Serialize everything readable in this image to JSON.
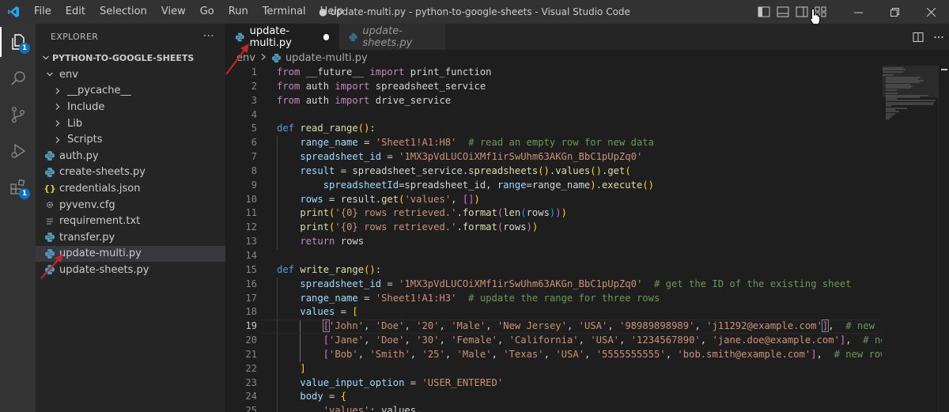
{
  "titlebar": {
    "menu": [
      "File",
      "Edit",
      "Selection",
      "View",
      "Go",
      "Run",
      "Terminal",
      "Help"
    ],
    "window_title": "● update-multi.py - python-to-google-sheets - Visual Studio Code"
  },
  "activity_bar": {
    "explorer_badge": "1",
    "extensions_badge": "1"
  },
  "sidebar": {
    "header": "EXPLORER",
    "more": "···",
    "folder": "PYTHON-TO-GOOGLE-SHEETS",
    "items": [
      {
        "label": "env",
        "type": "folder-open",
        "depth": 0
      },
      {
        "label": "__pycache__",
        "type": "folder",
        "depth": 1
      },
      {
        "label": "Include",
        "type": "folder",
        "depth": 1
      },
      {
        "label": "Lib",
        "type": "folder",
        "depth": 1
      },
      {
        "label": "Scripts",
        "type": "folder",
        "depth": 1
      },
      {
        "label": "auth.py",
        "type": "py",
        "depth": 0
      },
      {
        "label": "create-sheets.py",
        "type": "py",
        "depth": 0
      },
      {
        "label": "credentials.json",
        "type": "json",
        "depth": 0
      },
      {
        "label": "pyvenv.cfg",
        "type": "cfg",
        "depth": 0
      },
      {
        "label": "requirement.txt",
        "type": "txt",
        "depth": 0
      },
      {
        "label": "transfer.py",
        "type": "py",
        "depth": 0
      },
      {
        "label": "update-multi.py",
        "type": "py",
        "depth": 0,
        "selected": true
      },
      {
        "label": "update-sheets.py",
        "type": "py",
        "depth": 0
      }
    ]
  },
  "tabs": [
    {
      "label": "update-multi.py",
      "active": true,
      "dirty": true
    },
    {
      "label": "update-sheets.py",
      "active": false,
      "dirty": false
    }
  ],
  "breadcrumb": {
    "folder": "env",
    "file": "update-multi.py"
  },
  "editor": {
    "current_line": 19,
    "lines": [
      {
        "n": "1",
        "tokens": [
          [
            "k",
            "from "
          ],
          [
            "p",
            "__future__ "
          ],
          [
            "k",
            "import "
          ],
          [
            "p",
            "print_function"
          ]
        ]
      },
      {
        "n": "2",
        "tokens": [
          [
            "k",
            "from "
          ],
          [
            "p",
            "auth "
          ],
          [
            "k",
            "import "
          ],
          [
            "p",
            "spreadsheet_service"
          ]
        ]
      },
      {
        "n": "3",
        "tokens": [
          [
            "k",
            "from "
          ],
          [
            "p",
            "auth "
          ],
          [
            "k",
            "import "
          ],
          [
            "p",
            "drive_service"
          ]
        ]
      },
      {
        "n": "4",
        "tokens": []
      },
      {
        "n": "5",
        "tokens": [
          [
            "kd",
            "def "
          ],
          [
            "f",
            "read_range"
          ],
          [
            "b1",
            "()"
          ],
          [
            "p",
            ":"
          ]
        ]
      },
      {
        "n": "6",
        "tokens": [
          [
            "p",
            "    "
          ],
          [
            "v",
            "range_name"
          ],
          [
            "p",
            " = "
          ],
          [
            "s",
            "'Sheet1!A1:H8'"
          ],
          [
            "p",
            "  "
          ],
          [
            "c",
            "# read an empty row for new data"
          ]
        ]
      },
      {
        "n": "7",
        "tokens": [
          [
            "p",
            "    "
          ],
          [
            "v",
            "spreadsheet_id"
          ],
          [
            "p",
            " = "
          ],
          [
            "s",
            "'1MX3pVdLUCOiXMf1irSwUhm63AKGn_BbC1pUpZq0'"
          ]
        ]
      },
      {
        "n": "8",
        "tokens": [
          [
            "p",
            "    "
          ],
          [
            "v",
            "result"
          ],
          [
            "p",
            " = spreadsheet_service."
          ],
          [
            "f",
            "spreadsheets"
          ],
          [
            "b1",
            "()"
          ],
          [
            "p",
            "."
          ],
          [
            "f",
            "values"
          ],
          [
            "b1",
            "()"
          ],
          [
            "p",
            "."
          ],
          [
            "f",
            "get"
          ],
          [
            "b1",
            "("
          ]
        ]
      },
      {
        "n": "9",
        "tokens": [
          [
            "p",
            "        "
          ],
          [
            "v",
            "spreadsheetId"
          ],
          [
            "p",
            "=spreadsheet_id, "
          ],
          [
            "v",
            "range"
          ],
          [
            "p",
            "=range_name"
          ],
          [
            "b1",
            ")"
          ],
          [
            "p",
            "."
          ],
          [
            "f",
            "execute"
          ],
          [
            "b1",
            "()"
          ]
        ]
      },
      {
        "n": "10",
        "tokens": [
          [
            "p",
            "    "
          ],
          [
            "v",
            "rows"
          ],
          [
            "p",
            " = result."
          ],
          [
            "f",
            "get"
          ],
          [
            "b1",
            "("
          ],
          [
            "s",
            "'values'"
          ],
          [
            "p",
            ", "
          ],
          [
            "b2",
            "[]"
          ],
          [
            "b1",
            ")"
          ]
        ]
      },
      {
        "n": "11",
        "tokens": [
          [
            "p",
            "    "
          ],
          [
            "f",
            "print"
          ],
          [
            "b1",
            "("
          ],
          [
            "s",
            "'{0} rows retrieved.'"
          ],
          [
            "p",
            "."
          ],
          [
            "f",
            "format"
          ],
          [
            "b2",
            "("
          ],
          [
            "f",
            "len"
          ],
          [
            "b3",
            "("
          ],
          [
            "p",
            "rows"
          ],
          [
            "b3",
            ")"
          ],
          [
            "b2",
            ")"
          ],
          [
            "b1",
            ")"
          ]
        ]
      },
      {
        "n": "12",
        "tokens": [
          [
            "p",
            "    "
          ],
          [
            "f",
            "print"
          ],
          [
            "b1",
            "("
          ],
          [
            "s",
            "'{0} rows retrieved.'"
          ],
          [
            "p",
            "."
          ],
          [
            "f",
            "format"
          ],
          [
            "b2",
            "("
          ],
          [
            "p",
            "rows"
          ],
          [
            "b2",
            ")"
          ],
          [
            "b1",
            ")"
          ]
        ]
      },
      {
        "n": "13",
        "tokens": [
          [
            "p",
            "    "
          ],
          [
            "k",
            "return "
          ],
          [
            "p",
            "rows"
          ]
        ]
      },
      {
        "n": "14",
        "tokens": []
      },
      {
        "n": "15",
        "tokens": [
          [
            "kd",
            "def "
          ],
          [
            "f",
            "write_range"
          ],
          [
            "b1",
            "()"
          ],
          [
            "p",
            ":"
          ]
        ]
      },
      {
        "n": "16",
        "tokens": [
          [
            "p",
            "    "
          ],
          [
            "v",
            "spreadsheet_id"
          ],
          [
            "p",
            " = "
          ],
          [
            "s",
            "'1MX3pVdLUCOiXMf1irSwUhm63AKGn_BbC1pUpZq0'"
          ],
          [
            "p",
            "  "
          ],
          [
            "c",
            "# get the ID of the existing sheet"
          ]
        ]
      },
      {
        "n": "17",
        "tokens": [
          [
            "p",
            "    "
          ],
          [
            "v",
            "range_name"
          ],
          [
            "p",
            " = "
          ],
          [
            "s",
            "'Sheet1!A1:H3'"
          ],
          [
            "p",
            "  "
          ],
          [
            "c",
            "# update the range for three rows"
          ]
        ]
      },
      {
        "n": "18",
        "tokens": [
          [
            "p",
            "    "
          ],
          [
            "v",
            "values"
          ],
          [
            "p",
            " = "
          ],
          [
            "b1",
            "["
          ]
        ]
      },
      {
        "n": "19",
        "tokens": [
          [
            "p",
            "        "
          ],
          [
            "b2",
            "["
          ],
          [
            "s",
            "'John'"
          ],
          [
            "p",
            ", "
          ],
          [
            "s",
            "'Doe'"
          ],
          [
            "p",
            ", "
          ],
          [
            "s",
            "'20'"
          ],
          [
            "p",
            ", "
          ],
          [
            "s",
            "'Male'"
          ],
          [
            "p",
            ", "
          ],
          [
            "s",
            "'New Jersey'"
          ],
          [
            "p",
            ", "
          ],
          [
            "s",
            "'USA'"
          ],
          [
            "p",
            ", "
          ],
          [
            "s",
            "'98989898989'"
          ],
          [
            "p",
            ", "
          ],
          [
            "s",
            "'j11292@example.com'"
          ],
          [
            "b2",
            "]"
          ],
          [
            "p",
            ",  "
          ],
          [
            "c",
            "# new row"
          ]
        ]
      },
      {
        "n": "20",
        "tokens": [
          [
            "p",
            "        "
          ],
          [
            "b2",
            "["
          ],
          [
            "s",
            "'Jane'"
          ],
          [
            "p",
            ", "
          ],
          [
            "s",
            "'Doe'"
          ],
          [
            "p",
            ", "
          ],
          [
            "s",
            "'30'"
          ],
          [
            "p",
            ", "
          ],
          [
            "s",
            "'Female'"
          ],
          [
            "p",
            ", "
          ],
          [
            "s",
            "'California'"
          ],
          [
            "p",
            ", "
          ],
          [
            "s",
            "'USA'"
          ],
          [
            "p",
            ", "
          ],
          [
            "s",
            "'1234567890'"
          ],
          [
            "p",
            ", "
          ],
          [
            "s",
            "'jane.doe@example.com'"
          ],
          [
            "b2",
            "]"
          ],
          [
            "p",
            ",  "
          ],
          [
            "c",
            "# new row"
          ]
        ]
      },
      {
        "n": "21",
        "tokens": [
          [
            "p",
            "        "
          ],
          [
            "b2",
            "["
          ],
          [
            "s",
            "'Bob'"
          ],
          [
            "p",
            ", "
          ],
          [
            "s",
            "'Smith'"
          ],
          [
            "p",
            ", "
          ],
          [
            "s",
            "'25'"
          ],
          [
            "p",
            ", "
          ],
          [
            "s",
            "'Male'"
          ],
          [
            "p",
            ", "
          ],
          [
            "s",
            "'Texas'"
          ],
          [
            "p",
            ", "
          ],
          [
            "s",
            "'USA'"
          ],
          [
            "p",
            ", "
          ],
          [
            "s",
            "'5555555555'"
          ],
          [
            "p",
            ", "
          ],
          [
            "s",
            "'bob.smith@example.com'"
          ],
          [
            "b2",
            "]"
          ],
          [
            "p",
            ",  "
          ],
          [
            "c",
            "# new row"
          ]
        ]
      },
      {
        "n": "22",
        "tokens": [
          [
            "p",
            "    "
          ],
          [
            "b1",
            "]"
          ]
        ]
      },
      {
        "n": "23",
        "tokens": [
          [
            "p",
            "    "
          ],
          [
            "v",
            "value_input_option"
          ],
          [
            "p",
            " = "
          ],
          [
            "s",
            "'USER_ENTERED'"
          ]
        ]
      },
      {
        "n": "24",
        "tokens": [
          [
            "p",
            "    "
          ],
          [
            "v",
            "body"
          ],
          [
            "p",
            " = "
          ],
          [
            "b1",
            "{"
          ]
        ]
      },
      {
        "n": "25",
        "tokens": [
          [
            "p",
            "        "
          ],
          [
            "s",
            "'values'"
          ],
          [
            "p",
            ": values,"
          ]
        ]
      }
    ]
  }
}
